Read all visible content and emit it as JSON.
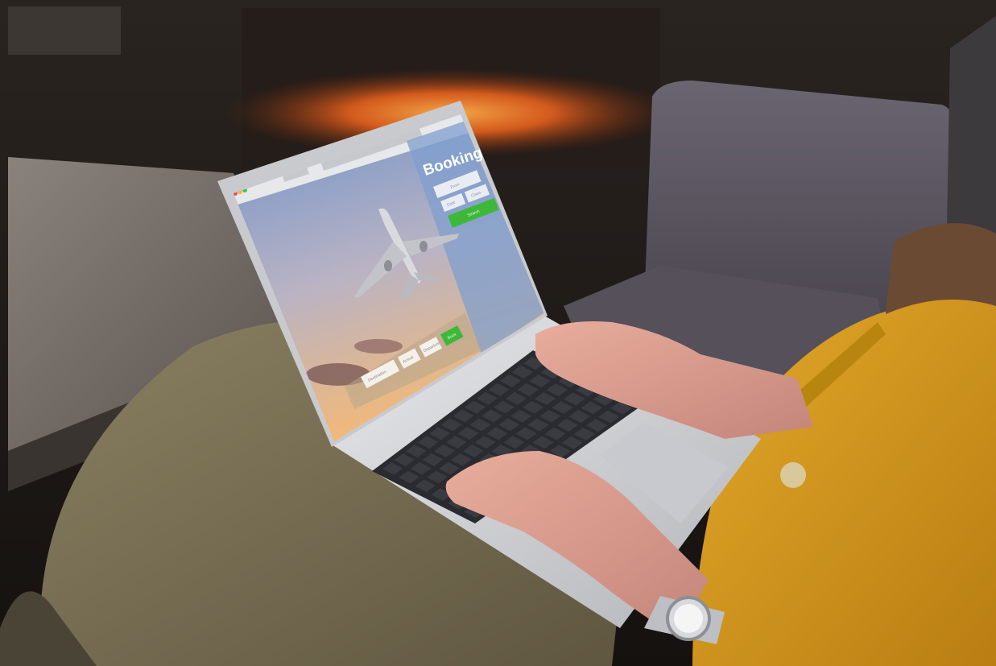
{
  "scene": {
    "description_free": true,
    "colors": {
      "room_dark": "#1b1714",
      "fireplace_glow": "#ff6a1e",
      "sofa_grey": "#5e5963",
      "table_grey": "#77706c",
      "pants_khaki": "#7a7052",
      "shirt_mustard": "#d79a1c",
      "skin": "#d99a8a",
      "laptop_silver": "#cfd0d4",
      "keyboard_dark": "#2a2b30"
    }
  },
  "booking_ui": {
    "title": "Booking",
    "form_fields": [
      {
        "name": "from",
        "placeholder": "From"
      },
      {
        "name": "date",
        "placeholder": "Date"
      },
      {
        "name": "class",
        "placeholder": "Class"
      }
    ],
    "form_submit_label": "Search",
    "bar_fields": [
      {
        "name": "destination",
        "placeholder": "Destination"
      },
      {
        "name": "arrival",
        "placeholder": "Arrival"
      },
      {
        "name": "departure",
        "placeholder": "Departure"
      }
    ],
    "bar_submit_label": "Book",
    "colors": {
      "accent_green": "#3fb83a",
      "panel_blue": "#7f9fce",
      "sky_top": "#6f92c8",
      "sky_bottom": "#f0b97a",
      "traffic_red": "#e84d3d",
      "traffic_yellow": "#f3b33c",
      "traffic_green": "#4fbf4a"
    }
  }
}
